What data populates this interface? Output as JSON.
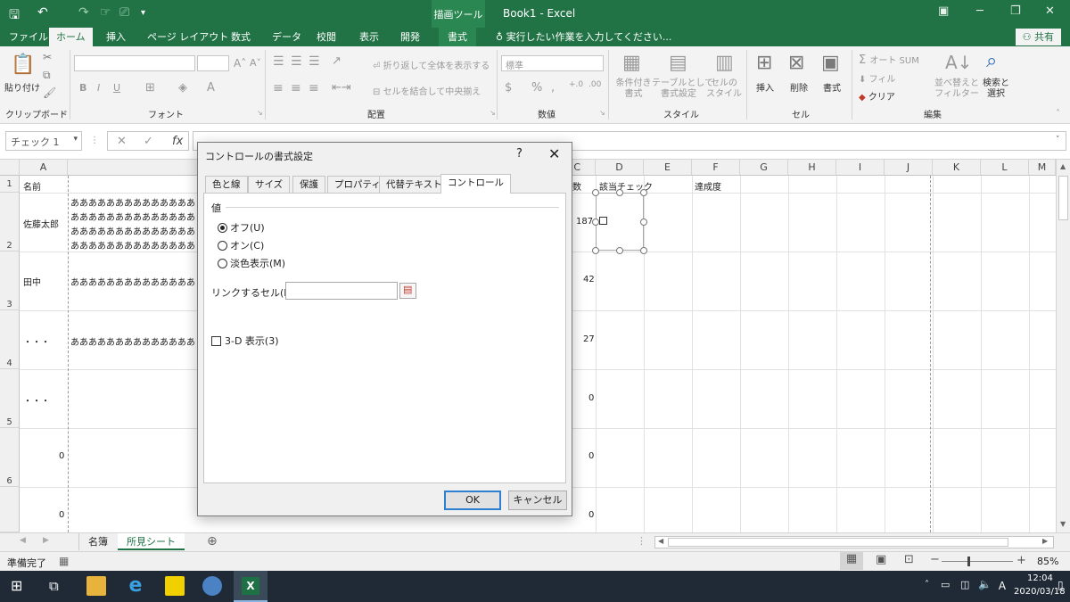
{
  "titlebar": {
    "context_tool": "描画ツール",
    "title": "Book1  -  Excel"
  },
  "ribbon_tabs": [
    "ファイル",
    "ホーム",
    "挿入",
    "ページ レイアウト",
    "数式",
    "データ",
    "校閲",
    "表示",
    "開発",
    "書式"
  ],
  "active_tab": "ホーム",
  "tell_me": "実行したい作業を入力してください...",
  "share_label": "共有",
  "ribbon": {
    "clipboard": {
      "paste": "貼り付け",
      "label": "クリップボード"
    },
    "font": {
      "label": "フォント",
      "bold": "B",
      "italic": "I",
      "underline": "U"
    },
    "alignment": {
      "wrap": "折り返して全体を表示する",
      "merge": "セルを結合して中央揃え",
      "label": "配置"
    },
    "number": {
      "format": "標準",
      "label": "数値"
    },
    "styles": {
      "cond": "条件付き\n書式",
      "table": "テーブルとして\n書式設定",
      "cell": "セルの\nスタイル",
      "label": "スタイル"
    },
    "cells": {
      "insert": "挿入",
      "delete": "削除",
      "format": "書式",
      "label": "セル"
    },
    "editing": {
      "autosum": "オート SUM",
      "fill": "フィル",
      "clear": "クリア",
      "sort": "並べ替えと\nフィルター",
      "find": "検索と\n選択",
      "label": "編集"
    }
  },
  "namebox": "チェック 1",
  "columns": [
    "A",
    "B",
    "C",
    "D",
    "E",
    "F",
    "G",
    "H",
    "I",
    "J",
    "K",
    "L",
    "M"
  ],
  "rows": [
    "1",
    "2",
    "3",
    "4",
    "5",
    "6"
  ],
  "cells": {
    "a1": "名前",
    "a2": "佐藤太郎",
    "a3": "田中",
    "a4": "・・・",
    "a5": "・・・",
    "a6": "0",
    "a7": "0",
    "b2_lines": [
      "ああああああああああああああ",
      "ああああああああああああああ",
      "ああああああああああああああ",
      "ああああああああああああああ"
    ],
    "b3": "ああああああああああああああ",
    "b4": "ああああああああああああああ",
    "c1": "数",
    "c2": "187",
    "c3": "42",
    "c4": "27",
    "c5": "0",
    "c6": "0",
    "c7": "0",
    "d1": "該当チェック",
    "f1": "達成度"
  },
  "sheets": [
    "名簿",
    "所見シート"
  ],
  "active_sheet": "所見シート",
  "status": {
    "ready": "準備完了",
    "zoom": "85%"
  },
  "taskbar": {
    "time": "12:04",
    "date": "2020/03/18"
  },
  "dialog": {
    "title": "コントロールの書式設定",
    "help": "?",
    "close": "✕",
    "tabs": [
      "色と線",
      "サイズ",
      "保護",
      "プロパティ",
      "代替テキスト",
      "コントロール"
    ],
    "active_tab": "コントロール",
    "value_section": "値",
    "radio_off": "オフ(U)",
    "radio_on": "オン(C)",
    "radio_mixed": "淡色表示(M)",
    "link_label": "リンクするセル(L):",
    "link_value": "",
    "three_d": "3-D 表示(3)",
    "ok": "OK",
    "cancel": "キャンセル"
  }
}
